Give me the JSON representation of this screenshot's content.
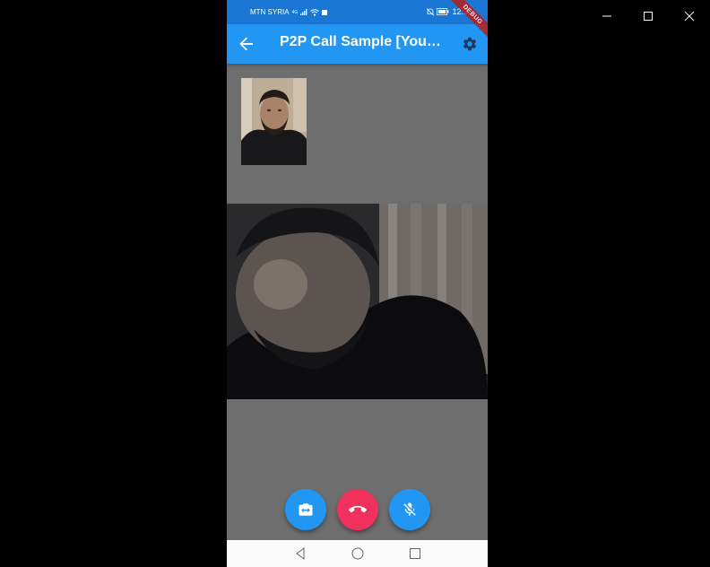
{
  "window": {
    "minimize_icon": "minimize-icon",
    "maximize_icon": "maximize-icon",
    "close_icon": "close-icon"
  },
  "status_bar": {
    "carrier": "MTN SYRIA",
    "network": "4G",
    "time": "12:3"
  },
  "app_bar": {
    "title": "P2P Call Sample [Your ...",
    "back_icon": "arrow-back-icon",
    "settings_icon": "settings-icon",
    "color": "#2196f3"
  },
  "debug_banner": {
    "label": "DEBUG"
  },
  "call": {
    "local_video": "local-video-feed",
    "remote_video": "remote-video-feed"
  },
  "controls": {
    "switch_camera_icon": "switch-camera-icon",
    "hangup_icon": "call-end-icon",
    "mute_icon": "mic-off-icon",
    "primary_color": "#2196f3",
    "hangup_color": "#f0305d"
  },
  "nav_bar": {
    "back_icon": "nav-back-icon",
    "home_icon": "nav-home-icon",
    "recents_icon": "nav-recents-icon"
  }
}
